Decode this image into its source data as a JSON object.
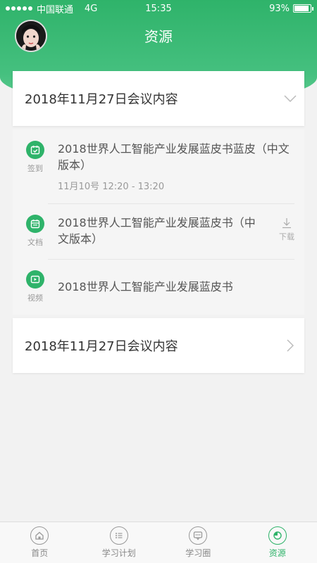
{
  "status_bar": {
    "carrier": "中国联通",
    "network": "4G",
    "time": "15:35",
    "battery": "93%",
    "battery_level": 0.93
  },
  "header": {
    "title": "资源"
  },
  "sections": [
    {
      "title": "2018年11月27日会议内容",
      "expanded": true,
      "items": [
        {
          "type_label": "签到",
          "icon": "calendar-check-icon",
          "title": "2018世界人工智能产业发展蓝皮书蓝皮（中文版本）",
          "subtitle": "11月10号  12:20 - 13:20"
        },
        {
          "type_label": "文档",
          "icon": "document-icon",
          "title": "2018世界人工智能产业发展蓝皮书（中文版本）",
          "action_label": "下载"
        },
        {
          "type_label": "视频",
          "icon": "play-icon",
          "title": "2018世界人工智能产业发展蓝皮书"
        }
      ]
    },
    {
      "title": "2018年11月27日会议内容",
      "expanded": false
    }
  ],
  "tabbar": {
    "tabs": [
      {
        "label": "首页",
        "icon": "home-icon"
      },
      {
        "label": "学习计划",
        "icon": "list-icon"
      },
      {
        "label": "学习圈",
        "icon": "chat-icon"
      },
      {
        "label": "资源",
        "icon": "resource-icon",
        "active": true
      }
    ]
  },
  "colors": {
    "accent": "#2fb36a"
  }
}
